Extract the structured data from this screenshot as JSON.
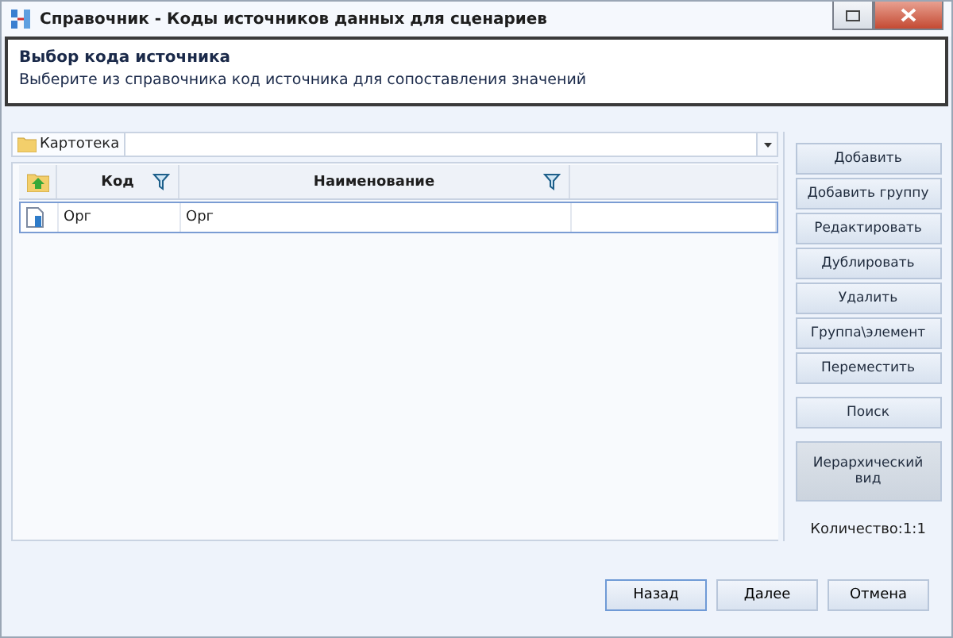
{
  "window": {
    "title": "Справочник - Коды источников данных для сценариев"
  },
  "header": {
    "title": "Выбор кода источника",
    "description": "Выберите из справочника код источника для сопоставления значений"
  },
  "breadcrumb": {
    "folder": "Картотека"
  },
  "table": {
    "columns": [
      {
        "label": "Код",
        "filter": true
      },
      {
        "label": "Наименование",
        "filter": true
      },
      {
        "filter": false
      }
    ],
    "rows": [
      {
        "cells": [
          "Орг",
          "Орг"
        ],
        "selected": true
      }
    ]
  },
  "actions": [
    {
      "label": "Добавить"
    },
    {
      "label": "Добавить группу"
    },
    {
      "label": "Редактировать"
    },
    {
      "label": "Дублировать"
    },
    {
      "label": "Удалить"
    },
    {
      "label": "Группа\\элемент"
    },
    {
      "label": "Переместить"
    }
  ],
  "view_actions": [
    {
      "label": "Поиск",
      "pressed": false
    },
    {
      "label": "Иерархический вид",
      "pressed": true
    }
  ],
  "count": "Количество:1:1",
  "footer_buttons": [
    {
      "label": "Назад",
      "selected": true
    },
    {
      "label": "Далее",
      "selected": false
    },
    {
      "label": "Отмена",
      "selected": false
    }
  ]
}
